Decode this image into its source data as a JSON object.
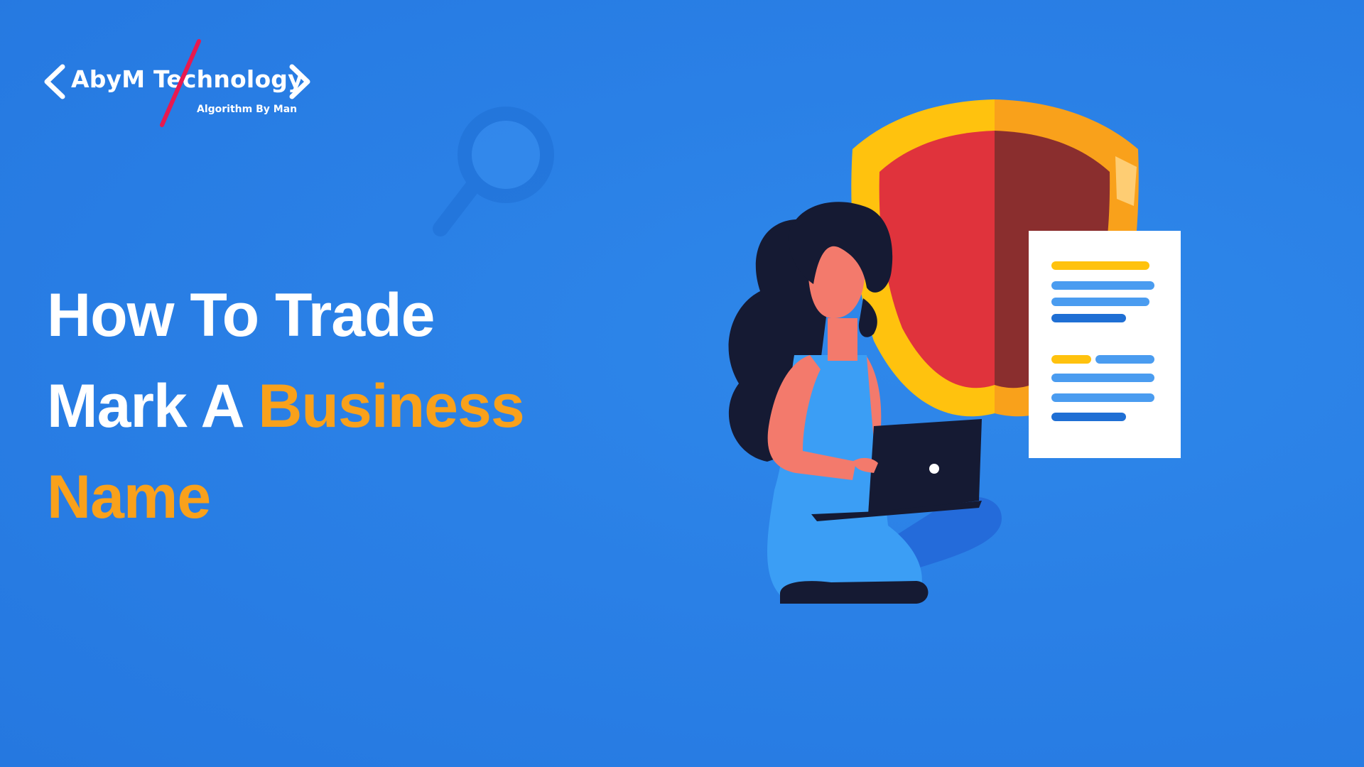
{
  "logo": {
    "brand": "AbyM Technology",
    "tagline": "Algorithm By Man",
    "icon": "code-brackets-icon"
  },
  "headline": {
    "line1": "How To Trade",
    "line2_plain": "Mark A ",
    "line2_accent": "Business",
    "line3_accent": "Name"
  },
  "colors": {
    "background": "#2a80e6",
    "accent": "#f9a11b",
    "logo_slash": "#e8194f",
    "shield_red": "#e0333c",
    "shield_dark": "#8a2e2e",
    "shield_rim": "#ffc20e"
  },
  "illustration": {
    "icons": [
      "magnifier-icon",
      "shield-icon",
      "document-icon",
      "laptop-icon",
      "woman-figure"
    ]
  }
}
